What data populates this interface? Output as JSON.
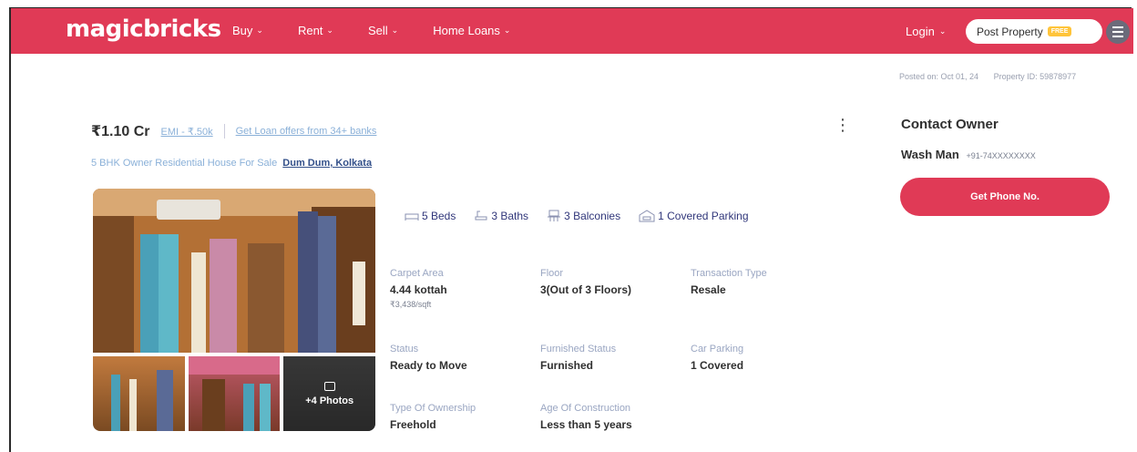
{
  "header": {
    "logo": "magicbricks",
    "nav": [
      {
        "label": "Buy"
      },
      {
        "label": "Rent"
      },
      {
        "label": "Sell"
      },
      {
        "label": "Home Loans"
      }
    ],
    "login_label": "Login",
    "post_property_label": "Post Property",
    "post_property_tag": "FREE"
  },
  "meta": {
    "posted_on": "Posted on: Oct 01, 24",
    "property_id": "Property ID: 59878977"
  },
  "listing": {
    "price": "₹1.10 Cr",
    "emi": "EMI - ₹.50k",
    "loan_offer": "Get Loan offers from 34+ banks",
    "subtitle": "5 BHK Owner Residential House For Sale",
    "location": "Dum Dum, Kolkata",
    "more_photos": "+4 Photos",
    "amenities": [
      {
        "label": "5 Beds",
        "icon": "bed-icon"
      },
      {
        "label": "3 Baths",
        "icon": "bath-icon"
      },
      {
        "label": "3 Balconies",
        "icon": "balcony-icon"
      },
      {
        "label": "1 Covered Parking",
        "icon": "parking-icon"
      }
    ],
    "details": {
      "carpet_area": {
        "label": "Carpet Area",
        "value": "4.44 kottah",
        "sub": "₹3,438/sqft"
      },
      "floor": {
        "label": "Floor",
        "value": "3(Out of 3 Floors)"
      },
      "transaction_type": {
        "label": "Transaction Type",
        "value": "Resale"
      },
      "status": {
        "label": "Status",
        "value": "Ready to Move"
      },
      "furnished_status": {
        "label": "Furnished Status",
        "value": "Furnished"
      },
      "car_parking": {
        "label": "Car Parking",
        "value": "1 Covered"
      },
      "ownership": {
        "label": "Type Of Ownership",
        "value": "Freehold"
      },
      "age": {
        "label": "Age Of Construction",
        "value": "Less than 5 years"
      }
    }
  },
  "contact": {
    "title": "Contact Owner",
    "name": "Wash Man",
    "phone": "+91-74XXXXXXXX",
    "button_label": "Get Phone No."
  },
  "colors": {
    "brand": "#e03a56",
    "link": "#8ab0d8",
    "free_tag": "#ffc43a"
  }
}
